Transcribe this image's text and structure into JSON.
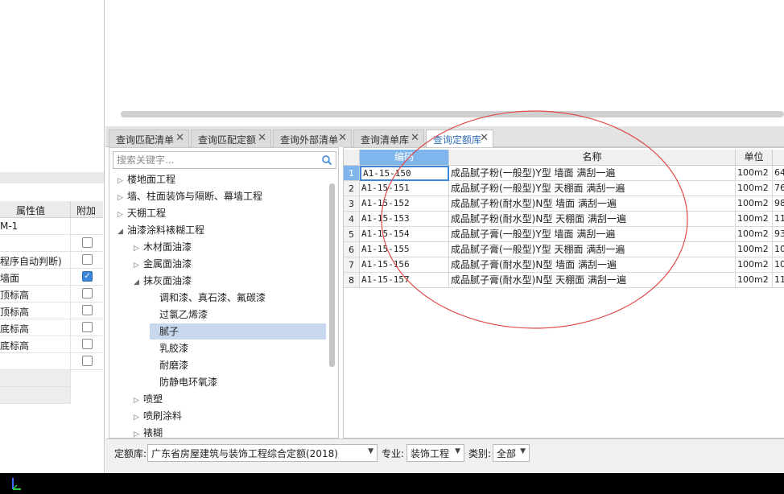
{
  "property_panel": {
    "headers": {
      "value": "属性值",
      "extra": "附加"
    },
    "rows": [
      {
        "value": "M-1",
        "checkbox": "none"
      },
      {
        "value": "",
        "checkbox": "unchecked"
      },
      {
        "value": "程序自动判断)",
        "checkbox": "unchecked"
      },
      {
        "value": "墙面",
        "checkbox": "checked"
      },
      {
        "value": "顶标高",
        "checkbox": "unchecked"
      },
      {
        "value": "顶标高",
        "checkbox": "unchecked"
      },
      {
        "value": "底标高",
        "checkbox": "unchecked"
      },
      {
        "value": "底标高",
        "checkbox": "unchecked"
      },
      {
        "value": "",
        "checkbox": "unchecked"
      }
    ]
  },
  "tabs": [
    {
      "label": "查询匹配清单",
      "active": false
    },
    {
      "label": "查询匹配定额",
      "active": false
    },
    {
      "label": "查询外部清单",
      "active": false
    },
    {
      "label": "查询清单库",
      "active": false
    },
    {
      "label": "查询定额库",
      "active": true
    }
  ],
  "search": {
    "placeholder": "搜索关键字..."
  },
  "tree": [
    {
      "label": "楼地面工程",
      "level": 0,
      "arrow": "collapsed"
    },
    {
      "label": "墙、柱面装饰与隔断、幕墙工程",
      "level": 0,
      "arrow": "collapsed"
    },
    {
      "label": "天棚工程",
      "level": 0,
      "arrow": "collapsed"
    },
    {
      "label": "油漆涂料裱糊工程",
      "level": 0,
      "arrow": "expanded"
    },
    {
      "label": "木材面油漆",
      "level": 1,
      "arrow": "collapsed"
    },
    {
      "label": "金属面油漆",
      "level": 1,
      "arrow": "collapsed"
    },
    {
      "label": "抹灰面油漆",
      "level": 1,
      "arrow": "expanded"
    },
    {
      "label": "调和漆、真石漆、氟碳漆",
      "level": 2,
      "arrow": "none"
    },
    {
      "label": "过氯乙烯漆",
      "level": 2,
      "arrow": "none"
    },
    {
      "label": "腻子",
      "level": 2,
      "arrow": "none",
      "selected": true
    },
    {
      "label": "乳胶漆",
      "level": 2,
      "arrow": "none"
    },
    {
      "label": "耐磨漆",
      "level": 2,
      "arrow": "none"
    },
    {
      "label": "防静电环氧漆",
      "level": 2,
      "arrow": "none"
    },
    {
      "label": "喷塑",
      "level": 1,
      "arrow": "collapsed"
    },
    {
      "label": "喷刷涂料",
      "level": 1,
      "arrow": "collapsed"
    },
    {
      "label": "裱糊",
      "level": 1,
      "arrow": "collapsed"
    }
  ],
  "grid": {
    "headers": {
      "code": "编码",
      "name": "名称",
      "unit": "单位"
    },
    "rows": [
      {
        "num": "1",
        "code": "A1-15-150",
        "name": "成品腻子粉(一般型)Y型 墙面 满刮一遍",
        "unit": "100m2",
        "extra": "64"
      },
      {
        "num": "2",
        "code": "A1-15-151",
        "name": "成品腻子粉(一般型)Y型 天棚面 满刮一遍",
        "unit": "100m2",
        "extra": "76"
      },
      {
        "num": "3",
        "code": "A1-15-152",
        "name": "成品腻子粉(耐水型)N型 墙面 满刮一遍",
        "unit": "100m2",
        "extra": "98"
      },
      {
        "num": "4",
        "code": "A1-15-153",
        "name": "成品腻子粉(耐水型)N型 天棚面 满刮一遍",
        "unit": "100m2",
        "extra": "11"
      },
      {
        "num": "5",
        "code": "A1-15-154",
        "name": "成品腻子膏(一般型)Y型 墙面 满刮一遍",
        "unit": "100m2",
        "extra": "93"
      },
      {
        "num": "6",
        "code": "A1-15-155",
        "name": "成品腻子膏(一般型)Y型 天棚面 满刮一遍",
        "unit": "100m2",
        "extra": "10"
      },
      {
        "num": "7",
        "code": "A1-15-156",
        "name": "成品腻子膏(耐水型)N型 墙面 满刮一遍",
        "unit": "100m2",
        "extra": "10"
      },
      {
        "num": "8",
        "code": "A1-15-157",
        "name": "成品腻子膏(耐水型)N型 天棚面 满刮一遍",
        "unit": "100m2",
        "extra": "11"
      }
    ]
  },
  "bottom_bar": {
    "quota_label": "定额库:",
    "quota_value": "广东省房屋建筑与装饰工程综合定额(2018)",
    "major_label": "专业:",
    "major_value": "装饰工程",
    "category_label": "类别:",
    "category_value": "全部"
  },
  "colors": {
    "accent": "#3b86d9",
    "header_highlight": "#7fb6ee",
    "selected_tree": "#c8d8ef",
    "annotation": "#e04a4a"
  },
  "icons": {
    "search": "search-icon",
    "close": "close-icon",
    "dropdown": "chevron-down-icon"
  }
}
